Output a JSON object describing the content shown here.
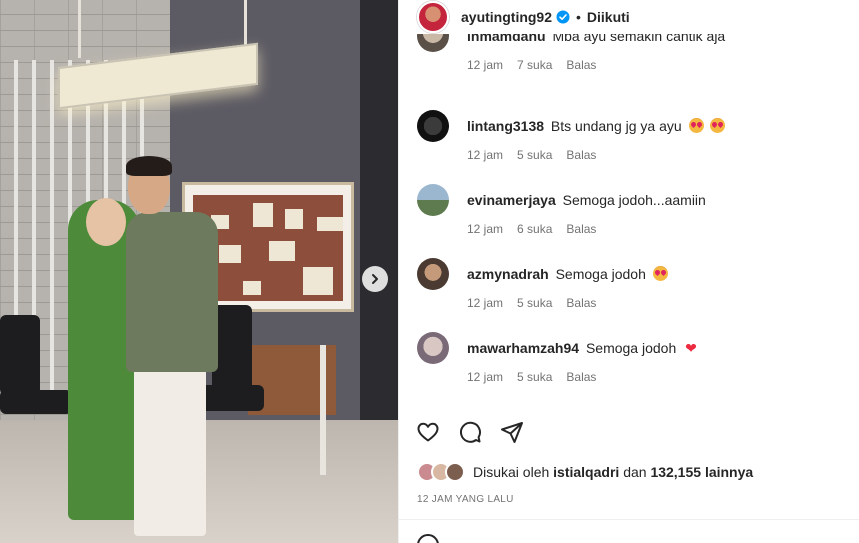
{
  "post": {
    "owner": "ayutingting92",
    "separator": "•",
    "follow_label": "Diikuti",
    "next_label": "›"
  },
  "comments": [
    {
      "user": "inmamdanu",
      "text": "Mba ayu semakin cantik aja",
      "time": "12 jam",
      "likes": "7 suka",
      "reply": "Balas",
      "emoji": ""
    },
    {
      "user": "lintang3138",
      "text": "Bts undang jg ya ayu",
      "time": "12 jam",
      "likes": "5 suka",
      "reply": "Balas",
      "emoji": "heart-eyes-x2"
    },
    {
      "user": "evinamerjaya",
      "text": "Semoga jodoh...aamiin",
      "time": "12 jam",
      "likes": "6 suka",
      "reply": "Balas",
      "emoji": ""
    },
    {
      "user": "azmynadrah",
      "text": "Semoga jodoh",
      "time": "12 jam",
      "likes": "5 suka",
      "reply": "Balas",
      "emoji": "heart-eyes"
    },
    {
      "user": "mawarhamzah94",
      "text": "Semoga jodoh",
      "time": "12 jam",
      "likes": "5 suka",
      "reply": "Balas",
      "emoji": "red-heart"
    }
  ],
  "likes": {
    "prefix": "Disukai oleh",
    "user": "istialqadri",
    "middle": "dan",
    "count": "132,155",
    "suffix": "lainnya"
  },
  "posted_time": "12 JAM YANG LALU",
  "icons": [
    "verified-badge-icon",
    "heart-icon",
    "comment-icon",
    "share-icon",
    "chevron-right-icon",
    "emoji-icon"
  ],
  "colors": {
    "verified": "#0095f6",
    "text": "#262626",
    "secondary": "#737373",
    "like_heart": "#ed2a3f"
  }
}
